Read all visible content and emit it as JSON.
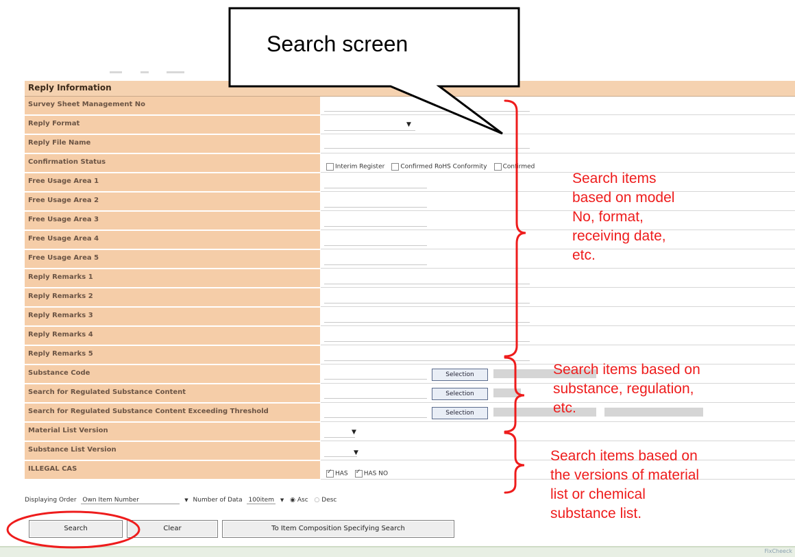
{
  "callout": {
    "text": "Search screen"
  },
  "section_title": "Reply Information",
  "rows": [
    {
      "label": "Survey Sheet Management No"
    },
    {
      "label": "Reply Format"
    },
    {
      "label": "Reply File Name"
    },
    {
      "label": "Confirmation Status"
    },
    {
      "label": "Free Usage Area 1"
    },
    {
      "label": "Free Usage Area 2"
    },
    {
      "label": "Free Usage Area 3"
    },
    {
      "label": "Free Usage Area 4"
    },
    {
      "label": "Free Usage Area 5"
    },
    {
      "label": "Reply Remarks 1"
    },
    {
      "label": "Reply Remarks 2"
    },
    {
      "label": "Reply Remarks 3"
    },
    {
      "label": "Reply Remarks 4"
    },
    {
      "label": "Reply Remarks 5"
    },
    {
      "label": "Substance Code"
    },
    {
      "label": "Search for Regulated Substance Content"
    },
    {
      "label": "Search for Regulated Substance Content Exceeding Threshold"
    },
    {
      "label": "Material List Version"
    },
    {
      "label": "Substance List Version"
    },
    {
      "label": "ILLEGAL CAS"
    }
  ],
  "confirmation": {
    "interim": "Interim Register",
    "rohs": "Confirmed RoHS Conformity",
    "confirmed": "Confirmed"
  },
  "selection_label": "Selection",
  "illegal_cas": {
    "has": "HAS",
    "has_no": "HAS NO"
  },
  "bottom": {
    "order_label": "Displaying Order",
    "order_value": "Own Item Number",
    "num_label": "Number of Data",
    "num_value": "100item",
    "asc": "Asc",
    "desc": "Desc"
  },
  "buttons": {
    "search": "Search",
    "clear": "Clear",
    "composition": "To Item Composition Specifying Search"
  },
  "status_text": "FixCheeck",
  "annotations": {
    "group1": [
      "Search items",
      "based on model",
      "No, format,",
      "receiving date,",
      "etc."
    ],
    "group2": [
      "Search items based on",
      "substance, regulation,",
      "etc."
    ],
    "group3": [
      "Search items based on",
      "the versions of material",
      "list or chemical",
      "substance list."
    ]
  },
  "colors": {
    "label_bg": "#f5cda8",
    "annotation": "#ee1c1c",
    "highlight": "#ee1c1c"
  }
}
